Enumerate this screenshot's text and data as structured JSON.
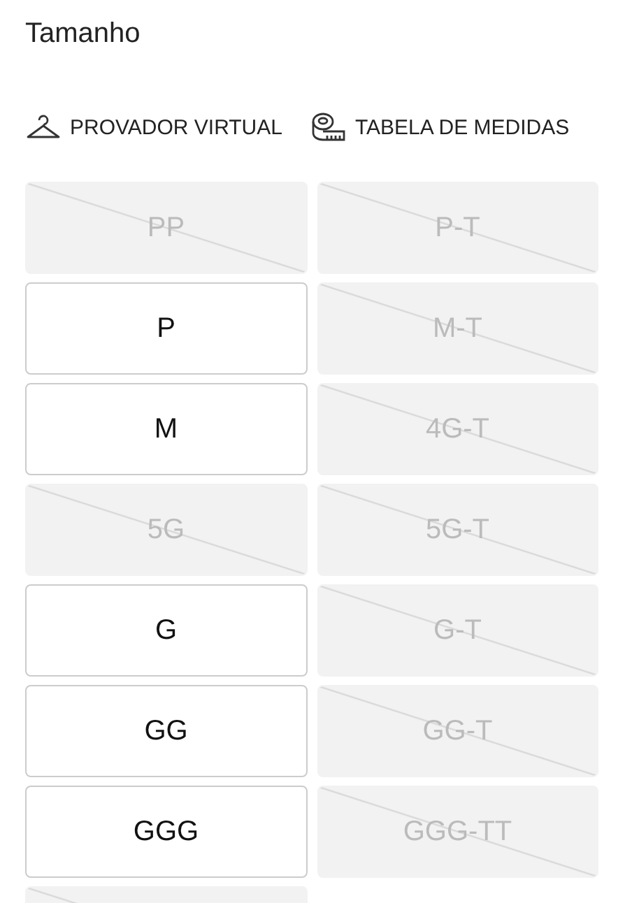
{
  "title": "Tamanho",
  "links": [
    {
      "kind": "hanger",
      "label": "PROVADOR VIRTUAL"
    },
    {
      "kind": "tape",
      "label": "TABELA DE MEDIDAS"
    }
  ],
  "sizes": [
    {
      "label": "PP",
      "available": false
    },
    {
      "label": "P-T",
      "available": false
    },
    {
      "label": "P",
      "available": true
    },
    {
      "label": "M-T",
      "available": false
    },
    {
      "label": "M",
      "available": true
    },
    {
      "label": "4G-T",
      "available": false
    },
    {
      "label": "5G",
      "available": false
    },
    {
      "label": "5G-T",
      "available": false
    },
    {
      "label": "G",
      "available": true
    },
    {
      "label": "G-T",
      "available": false
    },
    {
      "label": "GG",
      "available": true
    },
    {
      "label": "GG-T",
      "available": false
    },
    {
      "label": "GGG",
      "available": true
    },
    {
      "label": "GGG-TT",
      "available": false
    },
    {
      "available": false
    }
  ]
}
